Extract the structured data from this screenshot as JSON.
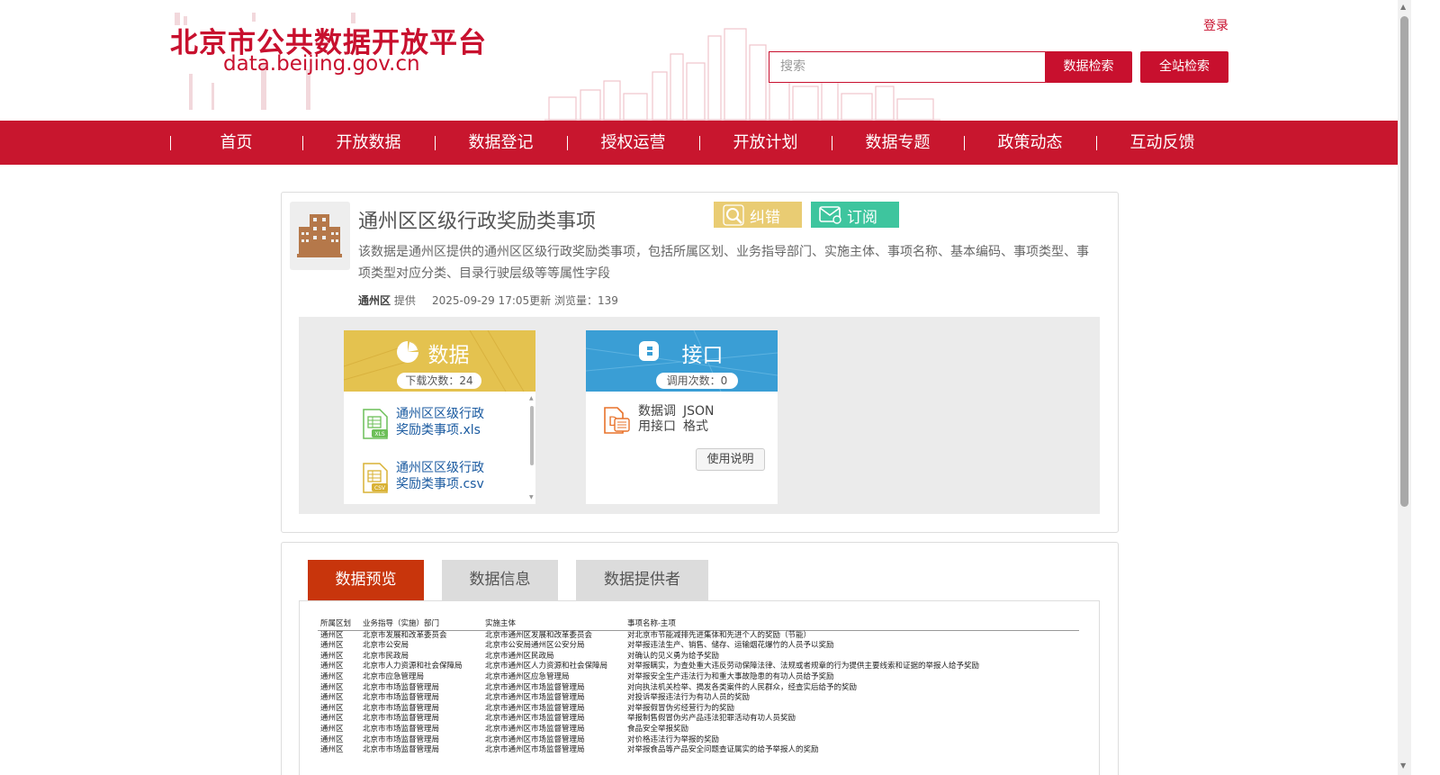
{
  "header": {
    "logo_cn": "北京市公共数据开放平台",
    "logo_en": "data.beijing.gov.cn",
    "login": "登录",
    "search_placeholder": "搜索",
    "btn_data_search": "数据检索",
    "btn_site_search": "全站检索",
    "brand_color": "#c8102e"
  },
  "nav": {
    "items": [
      "首页",
      "开放数据",
      "数据登记",
      "授权运营",
      "开放计划",
      "数据专题",
      "政策动态",
      "互动反馈"
    ]
  },
  "dataset": {
    "title": "通州区区级行政奖励类事项",
    "btn_error": "纠错",
    "btn_subscribe": "订阅",
    "description": "该数据是通州区提供的通州区区级行政奖励类事项，包括所属区划、业务指导部门、实施主体、事项名称、基本编码、事项类型、事项类型对应分类、目录行驶层级等等属性字段",
    "provider": "通州区",
    "provider_suffix": "提供",
    "updated": "2025-09-29 17:05更新",
    "views": "浏览量：139"
  },
  "data_panel": {
    "title": "数据",
    "count": "下载次数：24",
    "files": [
      {
        "name": "通州区区级行政奖励类事项.xls",
        "icon": "xls-file-icon"
      },
      {
        "name": "通州区区级行政奖励类事项.csv",
        "icon": "csv-file-icon"
      }
    ]
  },
  "api_panel": {
    "title": "接口",
    "count": "调用次数：0",
    "api_label_1": "数据调",
    "api_label_2": "用接口",
    "format_1": "JSON",
    "format_2": "格式",
    "btn_usage": "使用说明"
  },
  "tabs": {
    "preview": "数据预览",
    "info": "数据信息",
    "provider": "数据提供者"
  },
  "preview_table": {
    "headers": [
      "所属区划",
      "业务指导（实施）部门",
      "实施主体",
      "事项名称-主项"
    ],
    "rows": [
      [
        "通州区",
        "北京市发展和改革委员会",
        "北京市通州区发展和改革委员会",
        "对北京市节能减排先进集体和先进个人的奖励（节能）"
      ],
      [
        "通州区",
        "北京市公安局",
        "北京市公安局通州区公安分局",
        "对举报违法生产、销售、储存、运输烟花爆竹的人员予以奖励"
      ],
      [
        "通州区",
        "北京市民政局",
        "北京市通州区民政局",
        "对确认的见义勇为给予奖励"
      ],
      [
        "通州区",
        "北京市人力资源和社会保障局",
        "北京市通州区人力资源和社会保障局",
        "对举报瞒实，为查处重大违反劳动保障法律、法规或者规章的行为提供主要线索和证据的举报人给予奖励"
      ],
      [
        "通州区",
        "北京市应急管理局",
        "北京市通州区应急管理局",
        "对举报安全生产违法行为和重大事故隐患的有功人员给予奖励"
      ],
      [
        "通州区",
        "北京市市场监督管理局",
        "北京市通州区市场监督管理局",
        "对向执法机关检举、揭发各类案件的人民群众，经查实后给予的奖励"
      ],
      [
        "通州区",
        "北京市市场监督管理局",
        "北京市通州区市场监督管理局",
        "对投诉举报违法行为有功人员的奖励"
      ],
      [
        "通州区",
        "北京市市场监督管理局",
        "北京市通州区市场监督管理局",
        "对举报假冒伪劣经营行为的奖励"
      ],
      [
        "通州区",
        "北京市市场监督管理局",
        "北京市通州区市场监督管理局",
        "举报制售假冒伪劣产品违法犯罪活动有功人员奖励"
      ],
      [
        "通州区",
        "北京市市场监督管理局",
        "北京市通州区市场监督管理局",
        "食品安全举报奖励"
      ],
      [
        "通州区",
        "北京市市场监督管理局",
        "北京市通州区市场监督管理局",
        "对价格违法行为举报的奖励"
      ],
      [
        "通州区",
        "北京市市场监督管理局",
        "北京市通州区市场监督管理局",
        "对举报食品等产品安全问题查证属实的给予举报人的奖励"
      ]
    ]
  }
}
